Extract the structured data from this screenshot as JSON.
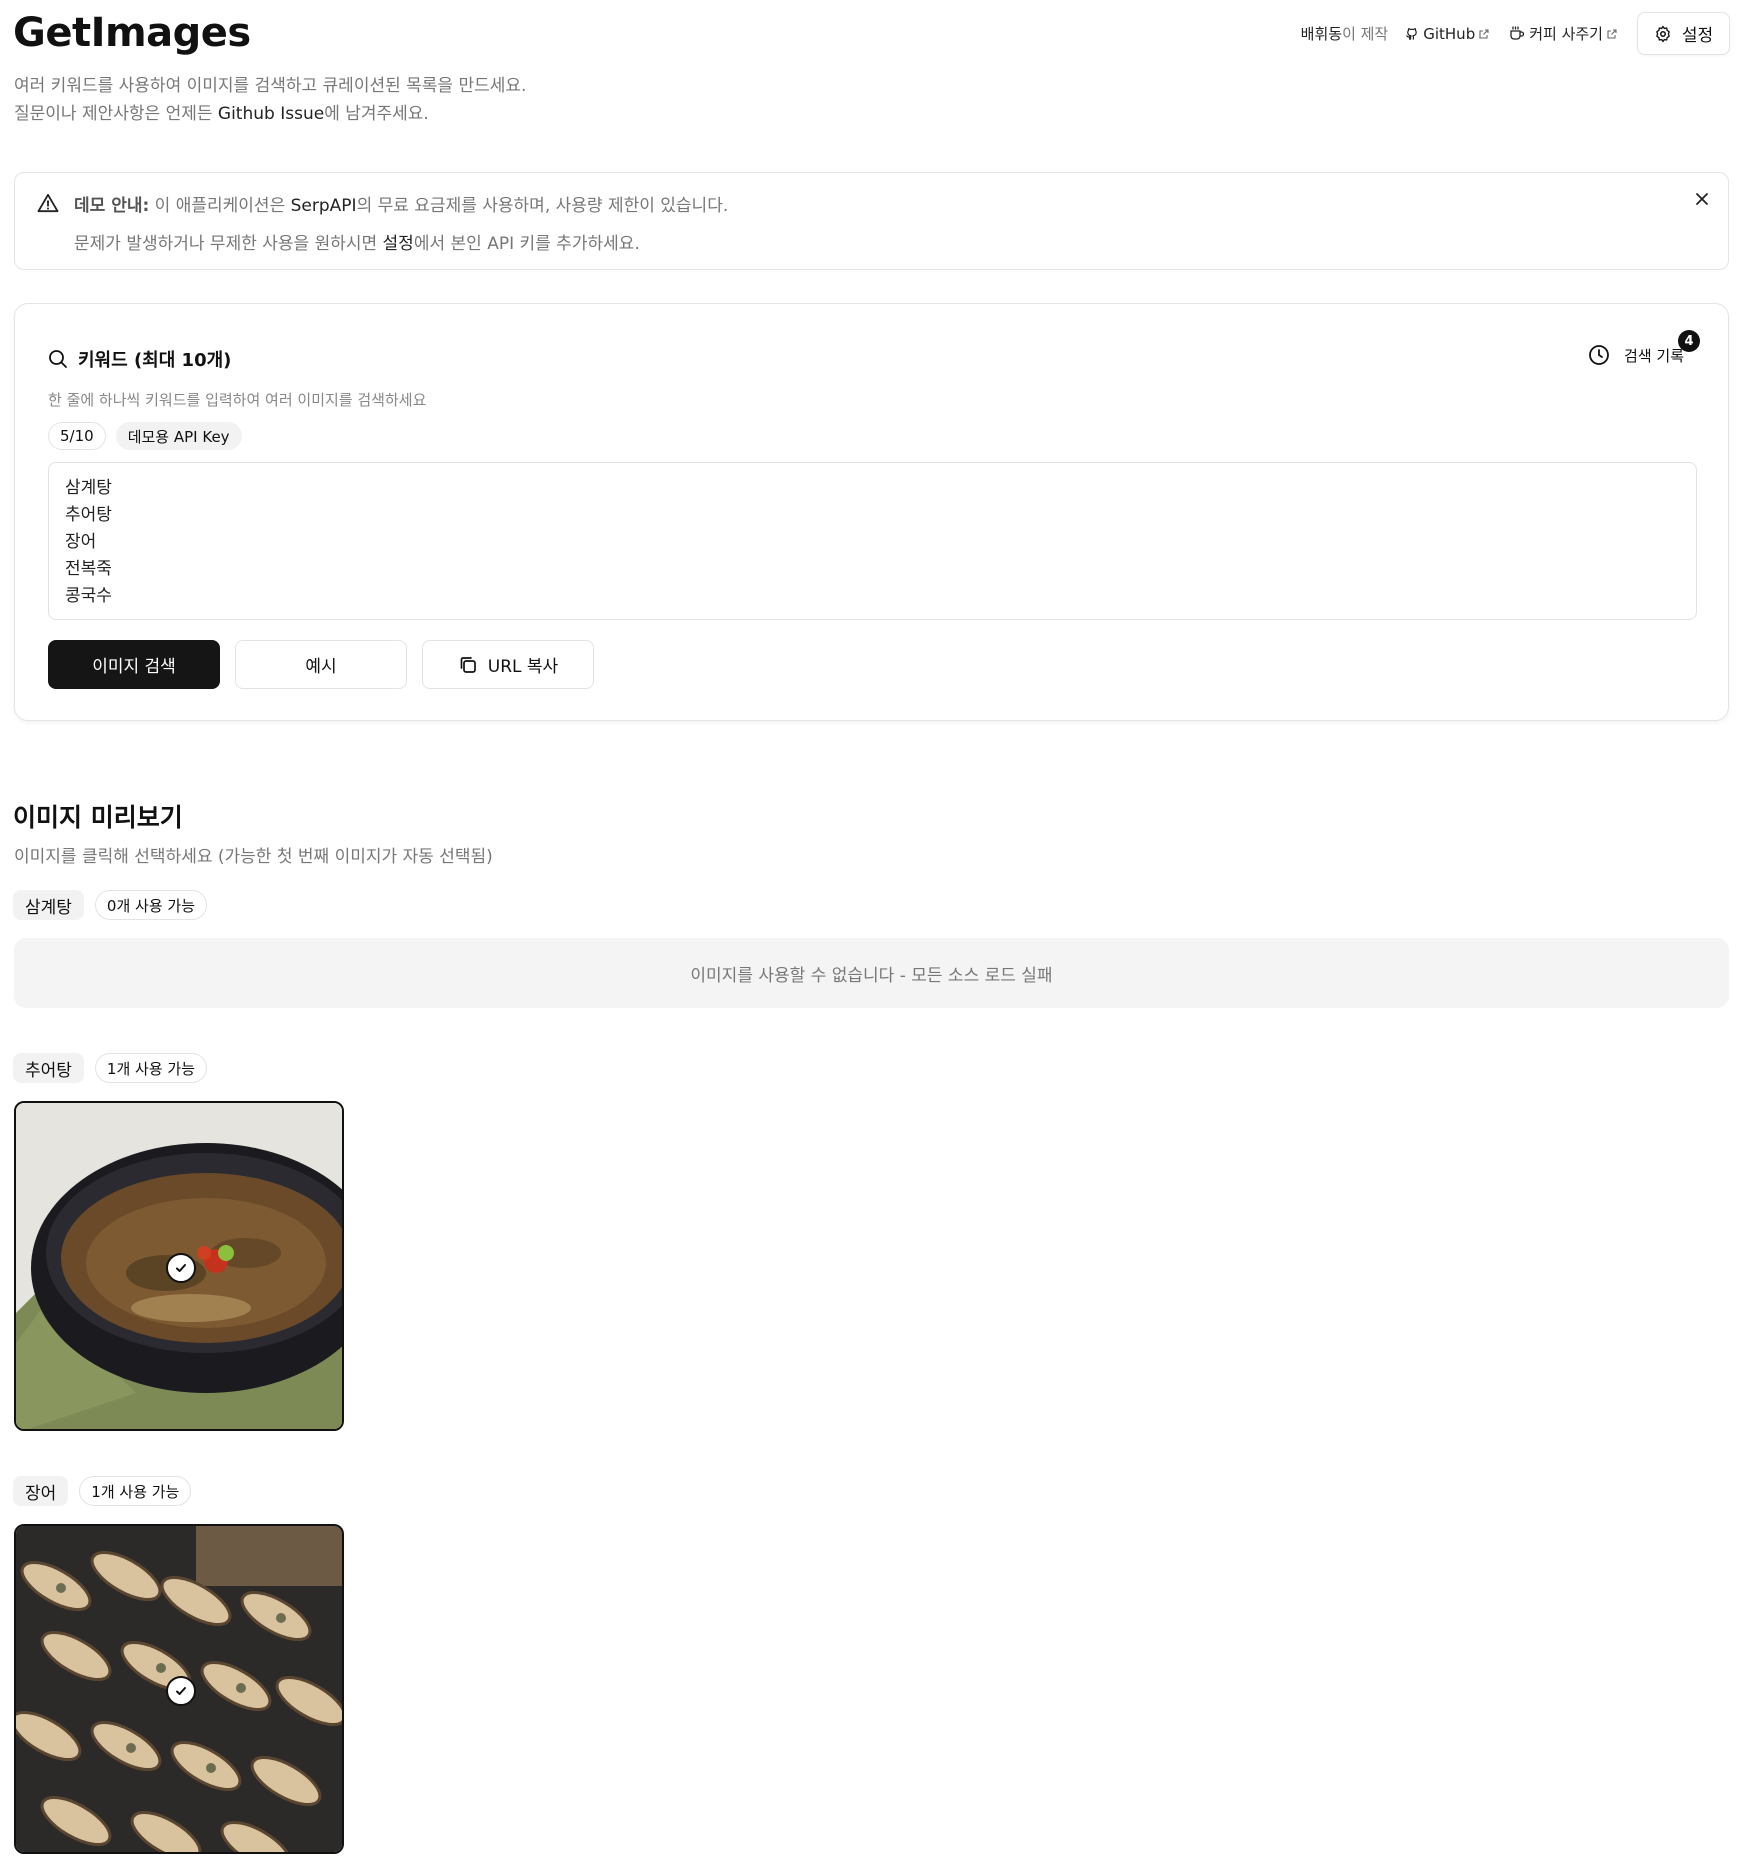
{
  "header": {
    "title": "GetImages",
    "subtitle_line1": "여러 키워드를 사용하여 이미지를 검색하고 큐레이션된 목록을 만드세요.",
    "subtitle_line2_prefix": "질문이나 제안사항은 언제든 ",
    "subtitle_line2_link": "Github Issue",
    "subtitle_line2_suffix": "에 남겨주세요.",
    "maker_name": "배휘동",
    "maker_suffix": "이 제작",
    "github_label": "GitHub",
    "coffee_label": "커피 사주기",
    "settings_label": "설정"
  },
  "alert": {
    "title": "데모 안내:",
    "line1_a": " 이 애플리케이션은 ",
    "line1_b": "SerpAPI",
    "line1_c": "의 무료 요금제를 사용하며, 사용량 제한이 있습니다.",
    "line2_a": "문제가 발생하거나 무제한 사용을 원하시면 ",
    "line2_b": "설정",
    "line2_c": "에서 본인 API 키를 추가하세요."
  },
  "search": {
    "title": "키워드 (최대 10개)",
    "history_label": "검색 기록",
    "history_count": "4",
    "description": "한 줄에 하나씩 키워드를 입력하여 여러 이미지를 검색하세요",
    "count_badge": "5/10",
    "api_badge": "데모용 API Key",
    "keywords": "삼계탕\n추어탕\n장어\n전복죽\n콩국수",
    "search_button": "이미지 검색",
    "example_button": "예시",
    "copy_url_button": "URL 복사"
  },
  "preview": {
    "title": "이미지 미리보기",
    "description": "이미지를 클릭해 선택하세요 (가능한 첫 번째 이미지가 자동 선택됨)",
    "groups": [
      {
        "keyword": "삼계탕",
        "available": "0개 사용 가능",
        "empty_message": "이미지를 사용할 수 없습니다 - 모든 소스 로드 실패"
      },
      {
        "keyword": "추어탕",
        "available": "1개 사용 가능"
      },
      {
        "keyword": "장어",
        "available": "1개 사용 가능"
      }
    ]
  },
  "icons": {
    "alert": "warning-triangle-icon",
    "close": "close-icon",
    "search": "search-icon",
    "history": "clock-icon",
    "copy": "copy-icon",
    "settings": "gear-icon",
    "github": "github-icon",
    "coffee": "coffee-icon",
    "check": "check-circle-icon"
  }
}
